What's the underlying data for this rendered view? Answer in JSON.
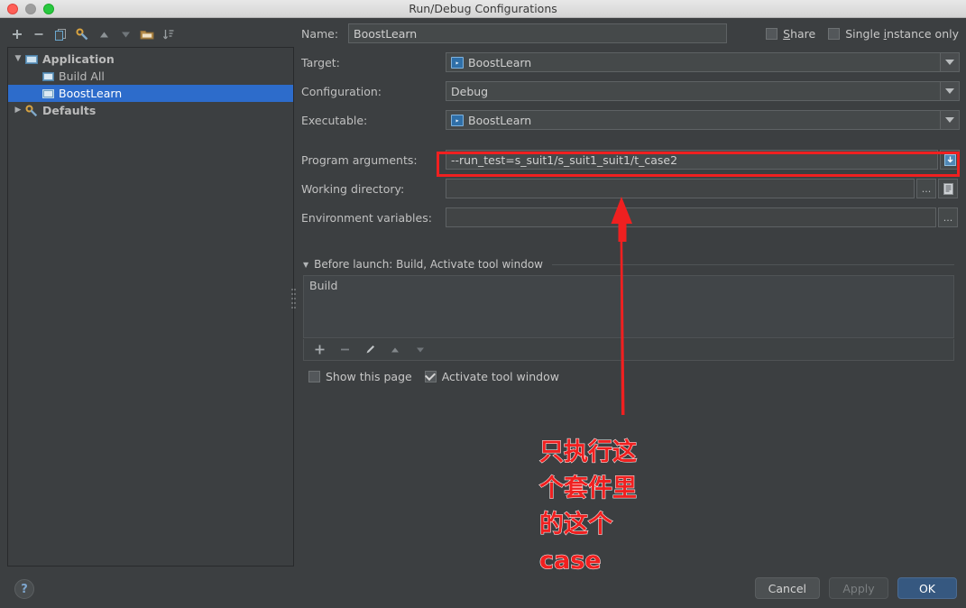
{
  "window": {
    "title": "Run/Debug Configurations",
    "traffic_lights": [
      "close-red",
      "minimize-disabled",
      "zoom-green"
    ]
  },
  "left_toolbar": {
    "buttons": [
      {
        "name": "add-configuration-button",
        "icon": "plus-icon",
        "label": "+"
      },
      {
        "name": "remove-configuration-button",
        "icon": "minus-icon",
        "label": "−"
      },
      {
        "name": "copy-configuration-button",
        "icon": "copy-icon",
        "label": "Copy"
      },
      {
        "name": "edit-defaults-button",
        "icon": "wrench-icon",
        "label": "Edit defaults"
      },
      {
        "name": "move-up-button",
        "icon": "arrow-up-icon",
        "label": "Move Up"
      },
      {
        "name": "move-down-button",
        "icon": "arrow-down-icon",
        "label": "Move Down"
      },
      {
        "name": "new-folder-button",
        "icon": "folder-icon",
        "label": "New Folder"
      },
      {
        "name": "sort-button",
        "icon": "sort-icon",
        "label": "Sort Configurations"
      }
    ]
  },
  "tree": {
    "nodes": [
      {
        "label": "Application",
        "icon": "application-icon",
        "expanded": true,
        "depth": 0,
        "selected": false,
        "bold": true
      },
      {
        "label": "Build All",
        "icon": "run-config-icon",
        "expanded": null,
        "depth": 1,
        "selected": false,
        "bold": false
      },
      {
        "label": "BoostLearn",
        "icon": "run-config-icon",
        "expanded": null,
        "depth": 1,
        "selected": true,
        "bold": false
      },
      {
        "label": "Defaults",
        "icon": "defaults-icon",
        "expanded": false,
        "depth": 0,
        "selected": false,
        "bold": true
      }
    ]
  },
  "form": {
    "name": {
      "label": "Name:",
      "value": "BoostLearn"
    },
    "target": {
      "label": "Target:",
      "value": "BoostLearn",
      "icon": "run-target-icon"
    },
    "configuration": {
      "label": "Configuration:",
      "value": "Debug"
    },
    "executable": {
      "label": "Executable:",
      "value": "BoostLearn",
      "icon": "run-target-icon"
    },
    "program_arguments": {
      "label": "Program arguments:",
      "value": "--run_test=s_suit1/s_suit1_suit1/t_case2",
      "expand_button": "expand-editor-icon"
    },
    "working_directory": {
      "label": "Working directory:",
      "value": "",
      "placeholder": "",
      "browse_button": "...",
      "macro_button": "macro-list-icon"
    },
    "environment_variables": {
      "label": "Environment variables:",
      "value": "",
      "placeholder": "",
      "browse_button": "..."
    }
  },
  "top_checkboxes": [
    {
      "label": "Share",
      "mnemonic": "S",
      "checked": false,
      "name": "share-checkbox"
    },
    {
      "label": "Single instance only",
      "mnemonic": "i",
      "checked": false,
      "name": "single-instance-only-checkbox"
    }
  ],
  "before_launch": {
    "header": "Before launch: Build, Activate tool window",
    "items": [
      "Build"
    ],
    "toolbar": [
      {
        "name": "add-task-button",
        "icon": "plus-icon"
      },
      {
        "name": "remove-task-button",
        "icon": "minus-icon"
      },
      {
        "name": "edit-task-button",
        "icon": "pencil-icon"
      },
      {
        "name": "move-task-up-button",
        "icon": "arrow-up-icon"
      },
      {
        "name": "move-task-down-button",
        "icon": "arrow-down-icon"
      }
    ],
    "checkboxes": [
      {
        "label": "Show this page",
        "checked": false,
        "name": "show-this-page-checkbox"
      },
      {
        "label": "Activate tool window",
        "checked": true,
        "name": "activate-tool-window-checkbox"
      }
    ]
  },
  "footer": {
    "help": "?",
    "cancel": "Cancel",
    "apply": "Apply",
    "ok": "OK",
    "apply_disabled": true
  },
  "annotation": {
    "color": "#f02020",
    "lines": [
      "只执行这",
      "个套件里",
      "的这个",
      "case"
    ],
    "highlight_target": "program-arguments-field",
    "arrow": "up-arrow-pointing-to-program-arguments"
  },
  "colors": {
    "dialog_bg": "#3c3f41",
    "selection_blue": "#2d6ccb",
    "primary_button": "#365880",
    "annotation_red": "#f02020",
    "titlebar_bg": "#e0e0e0"
  }
}
